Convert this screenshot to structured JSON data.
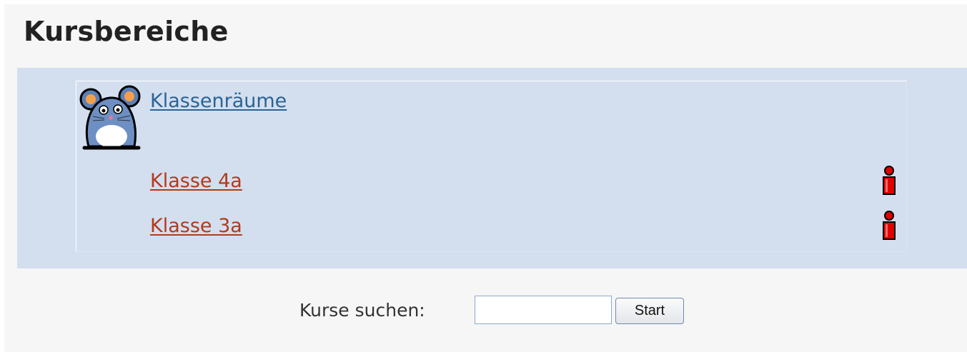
{
  "page": {
    "title": "Kursbereiche"
  },
  "category": {
    "icon": "mouse-mascot-icon",
    "name": "Klassenräume",
    "courses": [
      {
        "name": "Klasse 4a",
        "icon": "info-person-icon"
      },
      {
        "name": "Klasse 3a",
        "icon": "info-person-icon"
      }
    ]
  },
  "search": {
    "label": "Kurse suchen:",
    "value": "",
    "button_label": "Start"
  },
  "colors": {
    "category_background": "#d3dfef",
    "category_link": "#2a6496",
    "course_link": "#b23a1b",
    "info_icon": "#e00000"
  }
}
